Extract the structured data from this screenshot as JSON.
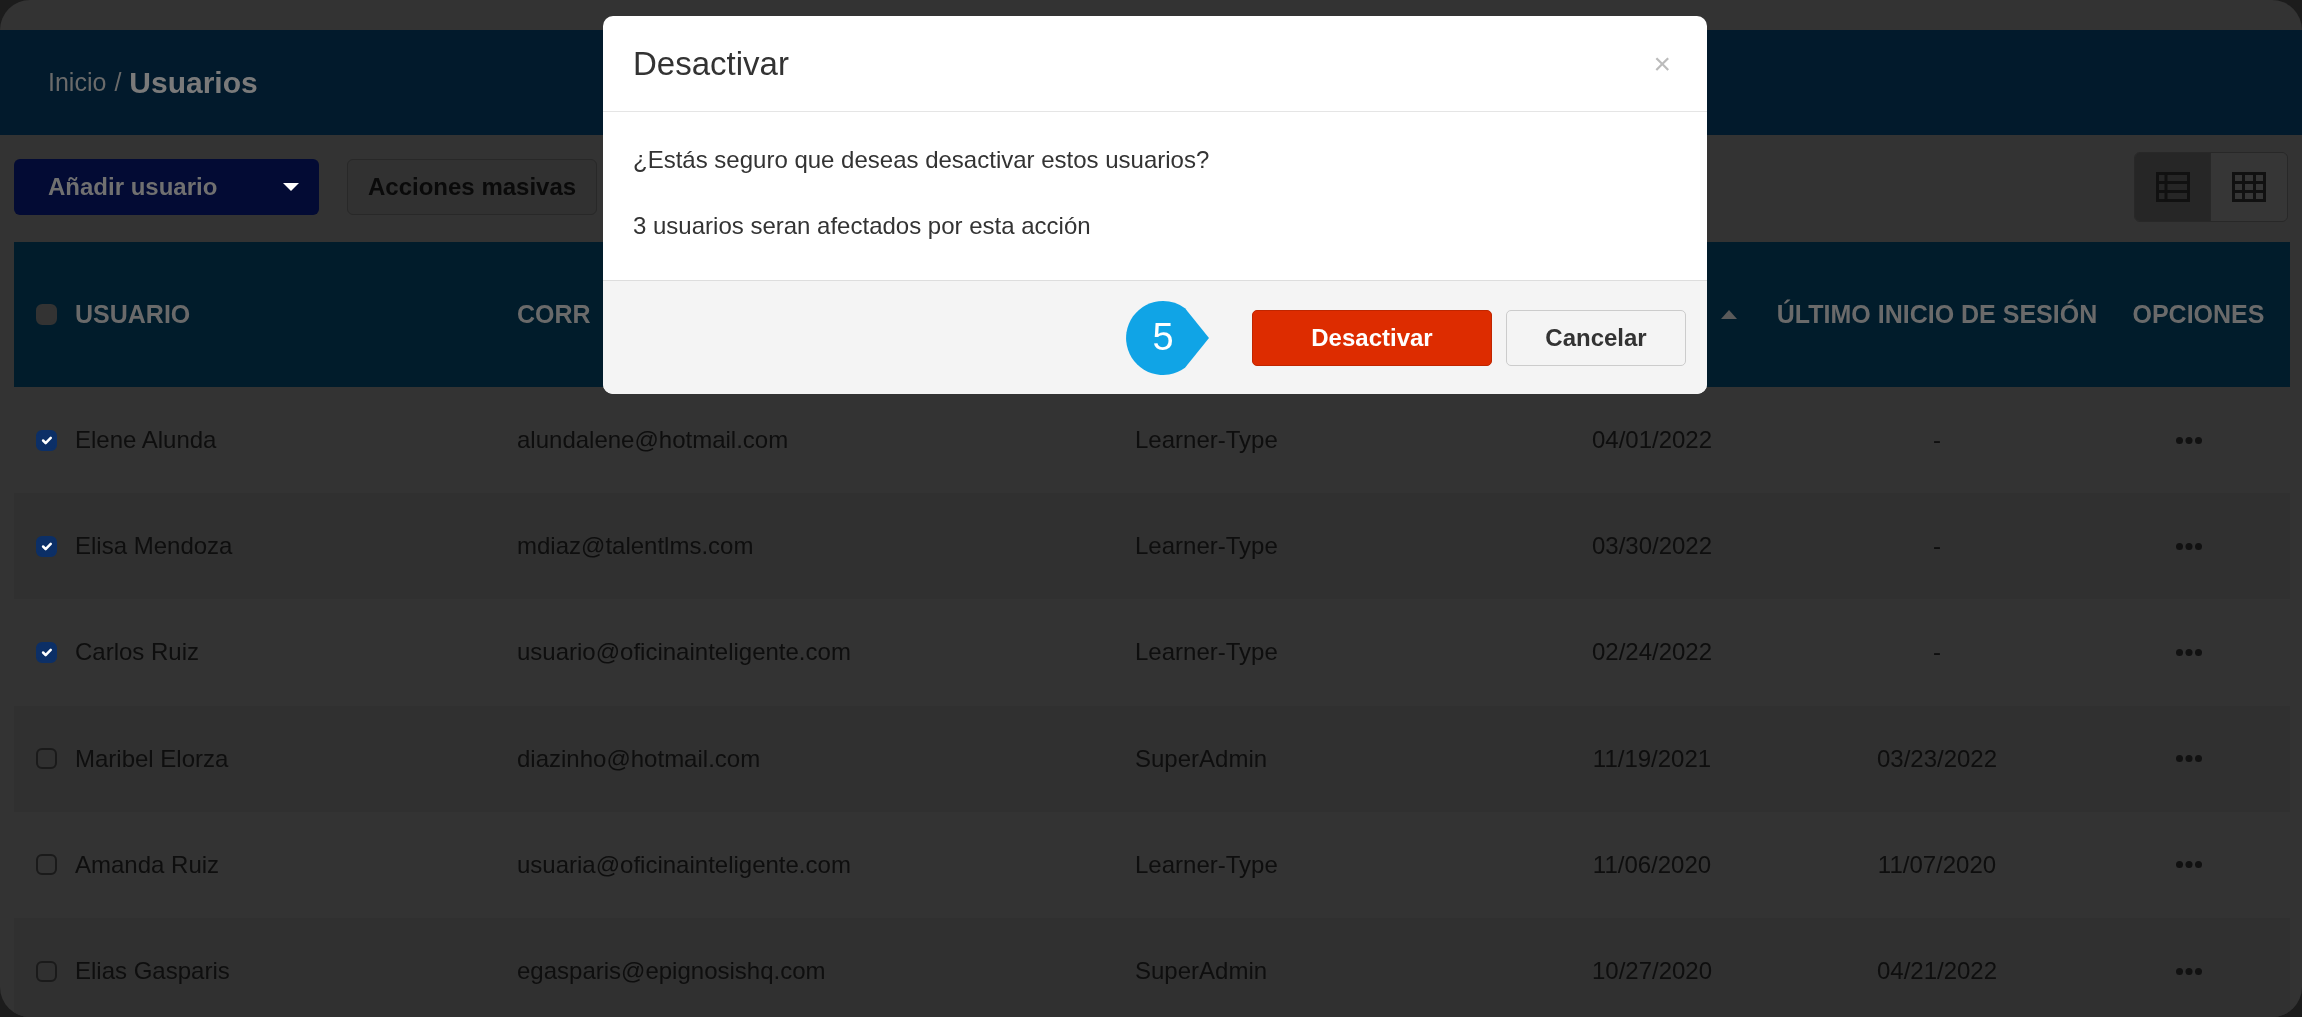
{
  "breadcrumb": {
    "parent": "Inicio",
    "separator": "/",
    "current": "Usuarios"
  },
  "toolbar": {
    "add_button": {
      "label": "Añadir usuario"
    },
    "bulk_button": {
      "label": "Acciones masivas"
    },
    "view_toggle": [
      {
        "kind": "list",
        "selected": true
      },
      {
        "kind": "grid",
        "selected": false
      }
    ]
  },
  "table": {
    "header": {
      "select_all_checked": false,
      "column_1": "USUARIO",
      "column_2": "CORR",
      "column_4_sort_ascending": true,
      "column_5": "ÚLTIMO INICIO DE SESIÓN",
      "column_6": "OPCIONES"
    },
    "rows": [
      {
        "checked": true,
        "user": "Elene Alunda",
        "email": "alundalene@hotmail.com",
        "type": "Learner-Type",
        "registered": "04/01/2022",
        "last_login": "-"
      },
      {
        "checked": true,
        "user": "Elisa Mendoza",
        "email": "mdiaz@talentlms.com",
        "type": "Learner-Type",
        "registered": "03/30/2022",
        "last_login": "-"
      },
      {
        "checked": true,
        "user": "Carlos Ruiz",
        "email": "usuario@oficinainteligente.com",
        "type": "Learner-Type",
        "registered": "02/24/2022",
        "last_login": "-"
      },
      {
        "checked": false,
        "user": "Maribel Elorza",
        "email": "diazinho@hotmail.com",
        "type": "SuperAdmin",
        "registered": "11/19/2021",
        "last_login": "03/23/2022"
      },
      {
        "checked": false,
        "user": "Amanda Ruiz",
        "email": "usuaria@oficinainteligente.com",
        "type": "Learner-Type",
        "registered": "11/06/2020",
        "last_login": "11/07/2020"
      },
      {
        "checked": false,
        "user": "Elias Gasparis",
        "email": "egasparis@epignosishq.com",
        "type": "SuperAdmin",
        "registered": "10/27/2020",
        "last_login": "04/21/2022"
      }
    ]
  },
  "modal": {
    "title": "Desactivar",
    "close": "×",
    "messages": [
      "¿Estás seguro que deseas desactivar estos usuarios?",
      "3 usuarios seran afectados por esta acción"
    ],
    "buttons": [
      {
        "kind": "danger",
        "label": "Desactivar"
      },
      {
        "kind": "secondary",
        "label": "Cancelar"
      }
    ],
    "callout": {
      "number": "5"
    }
  }
}
